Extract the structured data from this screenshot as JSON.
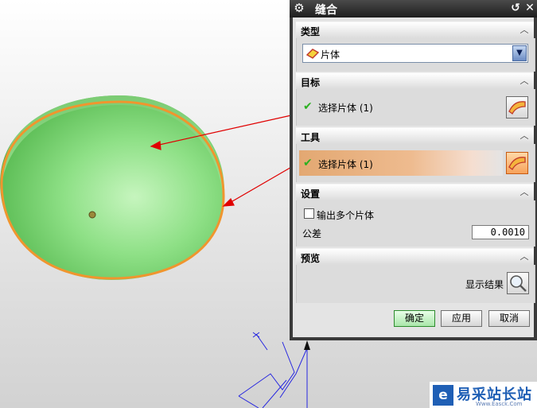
{
  "dialog": {
    "title": "缝合",
    "type_section": {
      "title": "类型",
      "selected": "片体"
    },
    "target_section": {
      "title": "目标",
      "select_label": "选择片体 (1)"
    },
    "tool_section": {
      "title": "工具",
      "select_label": "选择片体 (1)"
    },
    "settings_section": {
      "title": "设置",
      "multi_sheet_label": "输出多个片体",
      "multi_sheet_checked": false,
      "tolerance_label": "公差",
      "tolerance_value": "0.0010"
    },
    "preview_section": {
      "title": "预览",
      "show_result_label": "显示结果"
    },
    "buttons": {
      "ok": "确定",
      "apply": "应用",
      "cancel": "取消"
    },
    "icons": {
      "title": "gear-icon",
      "collapse": "chevron-up-icon",
      "dropdown": "chevron-down-icon",
      "check": "checkmark-icon",
      "sheet": "sheet-body-icon",
      "preview": "magnifier-icon"
    }
  },
  "colors": {
    "model_fill": "#8ee086",
    "model_edge": "#f0952e",
    "arrow": "#e00000",
    "tool_highlight": "#eebb8f",
    "wcs_axis": "#2626e0"
  },
  "watermark": {
    "text": "易采站长站",
    "url": "Www.Easck.Com"
  }
}
